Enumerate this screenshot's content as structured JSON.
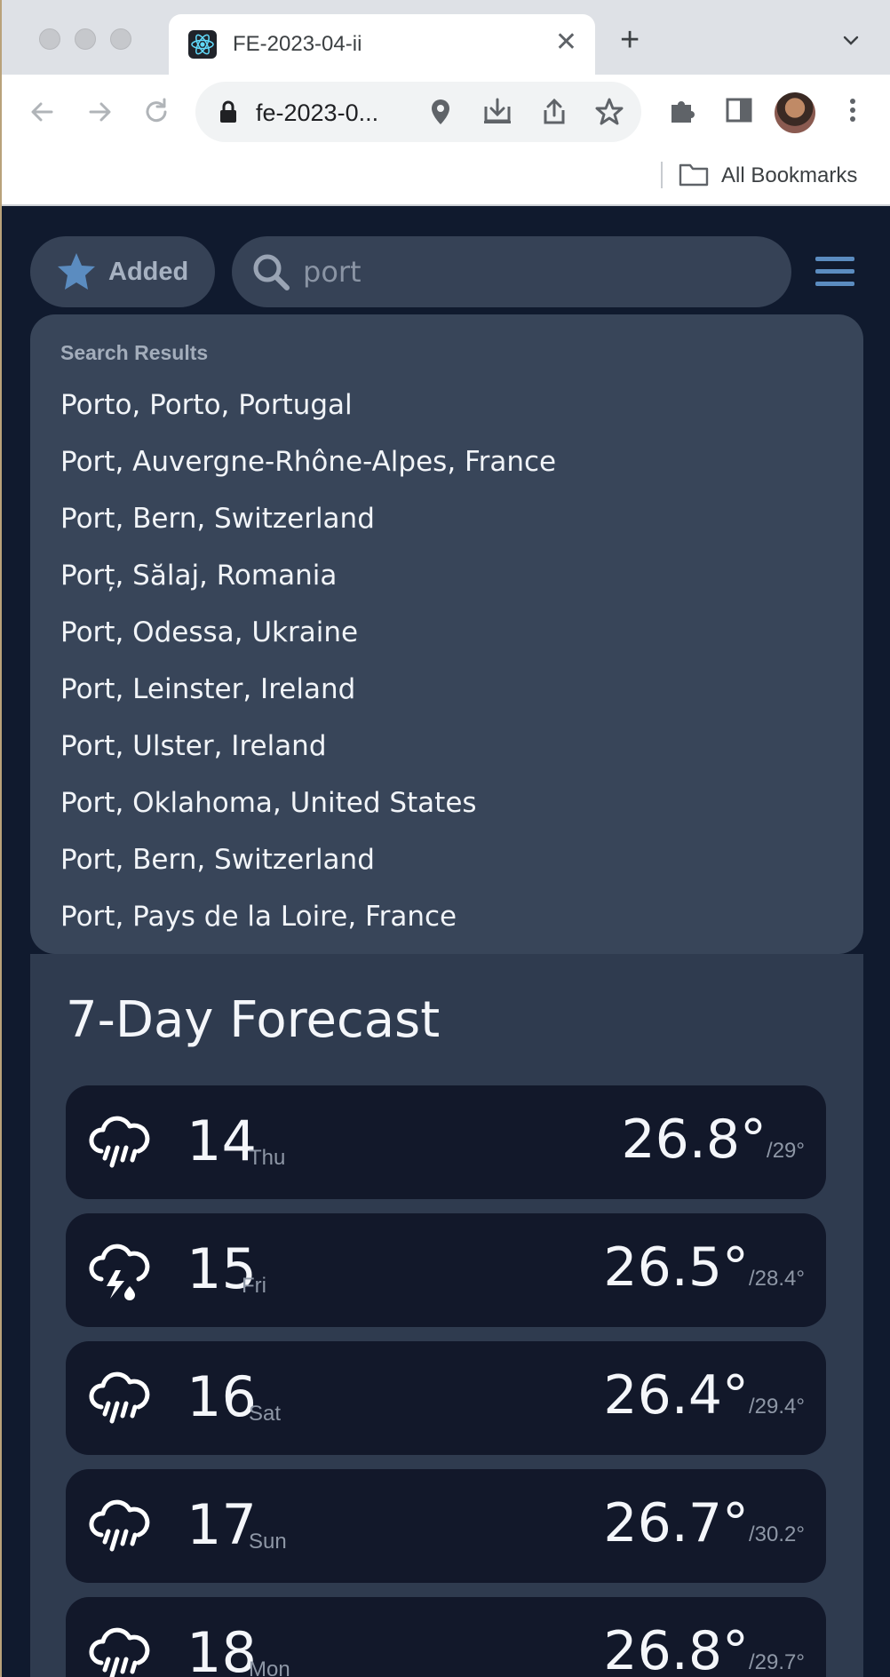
{
  "browser": {
    "tab_title": "FE-2023-04-ii",
    "url": "fe-2023-0...",
    "bookmarks_label": "All Bookmarks"
  },
  "app": {
    "added_label": "Added",
    "search_value": "port",
    "results_title": "Search Results",
    "results": [
      "Porto, Porto, Portugal",
      "Port, Auvergne-Rhône-Alpes, France",
      "Port, Bern, Switzerland",
      "Porț, Sălaj, Romania",
      "Port, Odessa, Ukraine",
      "Port, Leinster, Ireland",
      "Port, Ulster, Ireland",
      "Port, Oklahoma, United States",
      "Port, Bern, Switzerland",
      "Port, Pays de la Loire, France"
    ],
    "forecast_title": "7-Day Forecast",
    "days": [
      {
        "num": "14",
        "name": "Thu",
        "high": "26.8°",
        "low": "/29°",
        "icon": "rain-icon"
      },
      {
        "num": "15",
        "name": "Fri",
        "high": "26.5°",
        "low": "/28.4°",
        "icon": "thunderstorm-icon"
      },
      {
        "num": "16",
        "name": "Sat",
        "high": "26.4°",
        "low": "/29.4°",
        "icon": "rain-icon"
      },
      {
        "num": "17",
        "name": "Sun",
        "high": "26.7°",
        "low": "/30.2°",
        "icon": "rain-icon"
      },
      {
        "num": "18",
        "name": "Mon",
        "high": "26.8°",
        "low": "/29.7°",
        "icon": "rain-icon"
      }
    ]
  },
  "colors": {
    "app_background": "#101a2e",
    "panel": "#384559",
    "card": "#12182a",
    "accent": "#5b8cc0"
  }
}
